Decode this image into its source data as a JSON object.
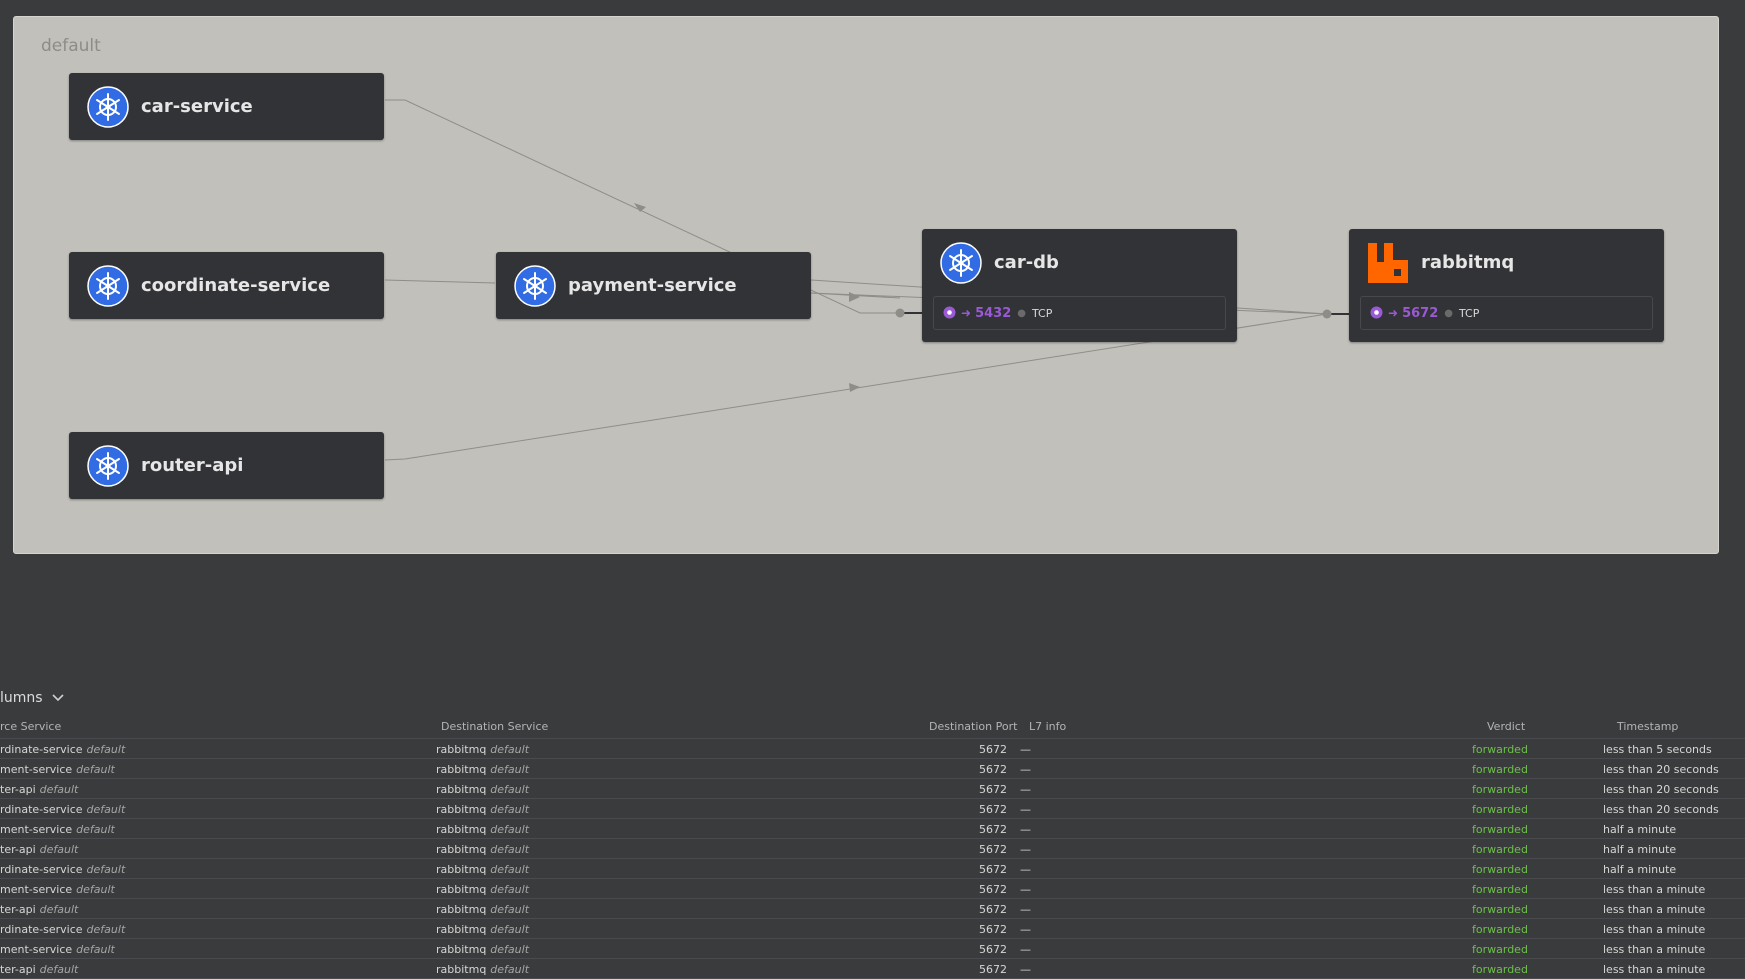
{
  "namespace": "default",
  "services": {
    "car_service": {
      "name": "car-service",
      "icon": "kubernetes-icon"
    },
    "coordinate_service": {
      "name": "coordinate-service",
      "icon": "kubernetes-icon"
    },
    "router_api": {
      "name": "router-api",
      "icon": "kubernetes-icon"
    },
    "payment_service": {
      "name": "payment-service",
      "icon": "kubernetes-icon"
    },
    "car_db": {
      "name": "car-db",
      "icon": "kubernetes-icon",
      "port": "5432",
      "protocol": "TCP"
    },
    "rabbitmq": {
      "name": "rabbitmq",
      "icon": "rabbitmq-icon",
      "port": "5672",
      "protocol": "TCP"
    }
  },
  "colors": {
    "kubernetes_blue": "#326ce5",
    "rabbitmq_orange": "#ff6600",
    "port_purple": "#9b59d6",
    "verdict_green": "#6cc04a"
  },
  "table": {
    "columns_label": "lumns",
    "headers": {
      "source": "rce Service",
      "destination": "Destination Service",
      "port": "Destination Port",
      "l7": "L7 info",
      "verdict": "Verdict",
      "timestamp": "Timestamp"
    },
    "rows": [
      {
        "src": "rdinate-service",
        "src_ns": "default",
        "dst": "rabbitmq",
        "dst_ns": "default",
        "port": "5672",
        "l7": "—",
        "verdict": "forwarded",
        "time": "less than 5 seconds"
      },
      {
        "src": "ment-service",
        "src_ns": "default",
        "dst": "rabbitmq",
        "dst_ns": "default",
        "port": "5672",
        "l7": "—",
        "verdict": "forwarded",
        "time": "less than 20 seconds"
      },
      {
        "src": "ter-api",
        "src_ns": "default",
        "dst": "rabbitmq",
        "dst_ns": "default",
        "port": "5672",
        "l7": "—",
        "verdict": "forwarded",
        "time": "less than 20 seconds"
      },
      {
        "src": "rdinate-service",
        "src_ns": "default",
        "dst": "rabbitmq",
        "dst_ns": "default",
        "port": "5672",
        "l7": "—",
        "verdict": "forwarded",
        "time": "less than 20 seconds"
      },
      {
        "src": "ment-service",
        "src_ns": "default",
        "dst": "rabbitmq",
        "dst_ns": "default",
        "port": "5672",
        "l7": "—",
        "verdict": "forwarded",
        "time": "half a minute"
      },
      {
        "src": "ter-api",
        "src_ns": "default",
        "dst": "rabbitmq",
        "dst_ns": "default",
        "port": "5672",
        "l7": "—",
        "verdict": "forwarded",
        "time": "half a minute"
      },
      {
        "src": "rdinate-service",
        "src_ns": "default",
        "dst": "rabbitmq",
        "dst_ns": "default",
        "port": "5672",
        "l7": "—",
        "verdict": "forwarded",
        "time": "half a minute"
      },
      {
        "src": "ment-service",
        "src_ns": "default",
        "dst": "rabbitmq",
        "dst_ns": "default",
        "port": "5672",
        "l7": "—",
        "verdict": "forwarded",
        "time": "less than a minute"
      },
      {
        "src": "ter-api",
        "src_ns": "default",
        "dst": "rabbitmq",
        "dst_ns": "default",
        "port": "5672",
        "l7": "—",
        "verdict": "forwarded",
        "time": "less than a minute"
      },
      {
        "src": "rdinate-service",
        "src_ns": "default",
        "dst": "rabbitmq",
        "dst_ns": "default",
        "port": "5672",
        "l7": "—",
        "verdict": "forwarded",
        "time": "less than a minute"
      },
      {
        "src": "ment-service",
        "src_ns": "default",
        "dst": "rabbitmq",
        "dst_ns": "default",
        "port": "5672",
        "l7": "—",
        "verdict": "forwarded",
        "time": "less than a minute"
      },
      {
        "src": "ter-api",
        "src_ns": "default",
        "dst": "rabbitmq",
        "dst_ns": "default",
        "port": "5672",
        "l7": "—",
        "verdict": "forwarded",
        "time": "less than a minute"
      }
    ]
  }
}
